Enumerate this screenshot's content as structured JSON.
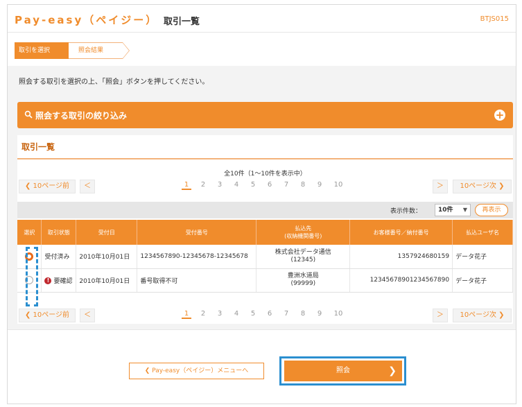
{
  "header": {
    "brand": "Pay-easy（ペイジー）",
    "title": "取引一覧",
    "screen_id": "BTJS015"
  },
  "steps": [
    "取引を選択",
    "照会結果"
  ],
  "instruction": "照会する取引を選択の上、「照会」ボタンを押してください。",
  "filter": {
    "label": "照会する取引の絞り込み"
  },
  "list": {
    "title": "取引一覧",
    "summary": "全10件（1〜10件を表示中）",
    "pager": {
      "prev10": "10ページ前",
      "next10": "10ページ次",
      "prev": "＜",
      "next": "＞",
      "pages": [
        "1",
        "2",
        "3",
        "4",
        "5",
        "6",
        "7",
        "8",
        "9",
        "10"
      ],
      "current": "1"
    },
    "display_count_label": "表示件数：",
    "display_count_value": "10件",
    "redisplay": "再表示",
    "columns": [
      "選択",
      "取引状態",
      "受付日",
      "受付番号",
      "払込先\n(収納機関番号)",
      "お客様番号／納付番号",
      "払込ユーザ名"
    ],
    "rows": [
      {
        "selected": true,
        "status": "受付済み",
        "warn": false,
        "date": "2010年10月01日",
        "receipt_no": "1234567890-12345678-12345678",
        "payee": "株式会社データ通信",
        "payee_code": "(12345)",
        "customer_no": "1357924680159",
        "user": "データ花子"
      },
      {
        "selected": false,
        "status": "要確認",
        "warn": true,
        "date": "2010年10月01日",
        "receipt_no": "番号取得不可",
        "payee": "豊洲水道局",
        "payee_code": "(99999)",
        "customer_no": "12345678901234567890",
        "user": "データ花子"
      }
    ]
  },
  "buttons": {
    "back": "Pay-easy（ペイジー）メニューへ",
    "ok": "照会"
  },
  "colors": {
    "accent": "#f08c2c",
    "highlight": "#2b8fd0",
    "warning": "#c0272d"
  }
}
